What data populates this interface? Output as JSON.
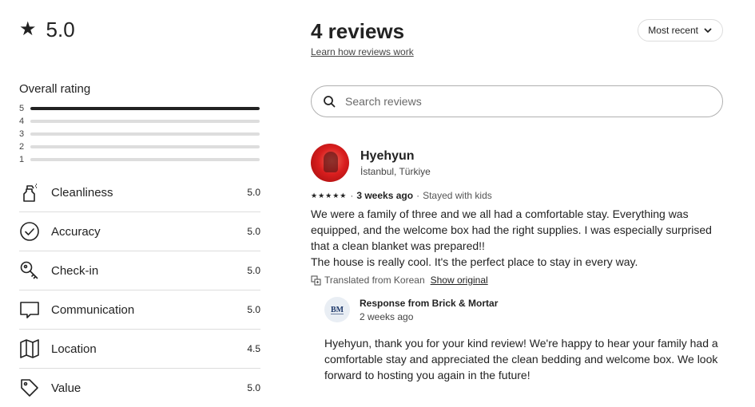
{
  "summary": {
    "star_glyph": "★",
    "score": "5.0"
  },
  "overall": {
    "title": "Overall rating",
    "distribution": [
      {
        "label": "5",
        "fraction": 1.0
      },
      {
        "label": "4",
        "fraction": 0
      },
      {
        "label": "3",
        "fraction": 0
      },
      {
        "label": "2",
        "fraction": 0
      },
      {
        "label": "1",
        "fraction": 0
      }
    ]
  },
  "categories": [
    {
      "name": "Cleanliness",
      "value": "5.0",
      "icon": "spray-bottle-icon"
    },
    {
      "name": "Accuracy",
      "value": "5.0",
      "icon": "check-circle-icon"
    },
    {
      "name": "Check-in",
      "value": "5.0",
      "icon": "key-icon"
    },
    {
      "name": "Communication",
      "value": "5.0",
      "icon": "chat-bubble-icon"
    },
    {
      "name": "Location",
      "value": "4.5",
      "icon": "map-icon"
    },
    {
      "name": "Value",
      "value": "5.0",
      "icon": "price-tag-icon"
    }
  ],
  "reviews_header": {
    "title": "4 reviews",
    "learn_link": "Learn how reviews work",
    "sort_label": "Most recent"
  },
  "search": {
    "placeholder": "Search reviews"
  },
  "review": {
    "name": "Hyehyun",
    "location": "İstanbul, Türkiye",
    "stars": "★★★★★",
    "separator": "·",
    "when": "3 weeks ago",
    "trip_type": "Stayed with kids",
    "text_line1": "We were a family of three and we all had a comfortable stay. Everything was equipped, and the welcome box had the right supplies. I was especially surprised that a clean blanket was prepared!!",
    "text_line2": "The house is really cool. It's the perfect place to stay in every way.",
    "translated": "Translated from Korean",
    "show_original": "Show original"
  },
  "response": {
    "logo_text": "BM",
    "title": "Response from Brick & Mortar",
    "when": "2 weeks ago",
    "text": "Hyehyun, thank you for your kind review! We're happy to hear your family had a comfortable stay and appreciated the clean bedding and welcome box. We look forward to hosting you again in the future!"
  },
  "colors": {
    "text": "#222222",
    "muted": "#6a6a6a",
    "divider": "#dddddd",
    "bar_fill": "#222222"
  }
}
